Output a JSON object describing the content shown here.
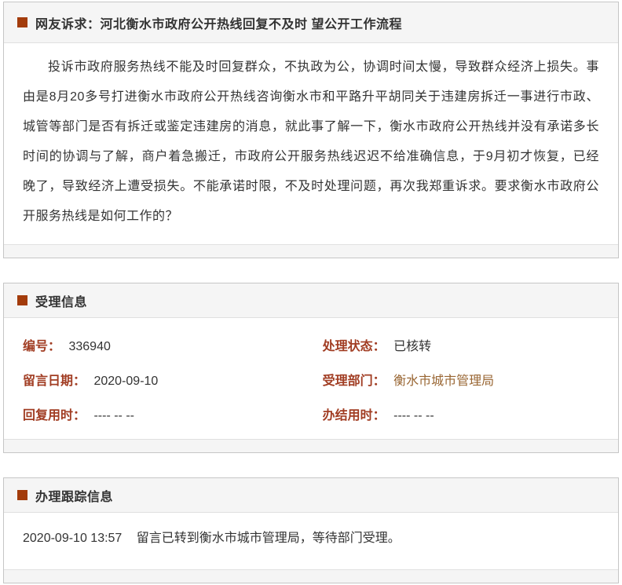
{
  "colors": {
    "accent_rust": "#a33c0b",
    "label_brown": "#a13d23",
    "link_brown": "#996633",
    "section_header_bg": "#f5f5f5",
    "body_text": "#333333",
    "card_border": "#c6c6c6"
  },
  "complaint": {
    "title": "网友诉求：河北衡水市政府公开热线回复不及时 望公开工作流程",
    "body": "投诉市政府服务热线不能及时回复群众，不执政为公，协调时间太慢，导致群众经济上损失。事由是8月20多号打进衡水市政府公开热线咨询衡水市和平路升平胡同关于违建房拆迁一事进行市政、城管等部门是否有拆迁或鉴定违建房的消息，就此事了解一下，衡水市政府公开热线并没有承诺多长时间的协调与了解，商户着急搬迁，市政府公开服务热线迟迟不给准确信息，于9月初才恢复，已经晚了，导致经济上遭受损失。不能承诺时限，不及时处理问题，再次我郑重诉求。要求衡水市政府公开服务热线是如何工作的？"
  },
  "acceptance": {
    "title": "受理信息",
    "number_label": "编号：",
    "number_value": "336940",
    "status_label": "处理状态：",
    "status_value": "已核转",
    "date_label": "留言日期：",
    "date_value": "2020-09-10",
    "dept_label": "受理部门：",
    "dept_value": "衡水市城市管理局",
    "reply_label": "回复用时：",
    "reply_value": "---- -- --",
    "finish_label": "办结用时：",
    "finish_value": "---- -- --"
  },
  "tracking": {
    "title": "办理跟踪信息",
    "entry_time": "2020-09-10 13:57",
    "entry_text": "留言已转到衡水市城市管理局，等待部门受理。"
  }
}
